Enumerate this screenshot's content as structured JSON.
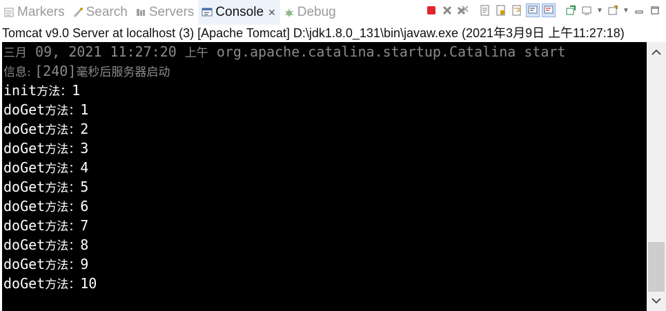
{
  "tabs": [
    {
      "label": "Markers",
      "icon": "markers-icon"
    },
    {
      "label": "Search",
      "icon": "search-icon"
    },
    {
      "label": "Servers",
      "icon": "servers-icon"
    },
    {
      "label": "Console",
      "icon": "console-icon",
      "close": "✕"
    },
    {
      "label": "Debug",
      "icon": "debug-icon"
    }
  ],
  "process_label": "Tomcat v9.0 Server at localhost (3) [Apache Tomcat] D:\\jdk1.8.0_131\\bin\\javaw.exe (2021年3月9日 上午11:27:18)",
  "console": {
    "log_line_1": {
      "prefix": "三月",
      "time": " 09, 2021 11:27:20 ",
      "ampm": "上午",
      "class": " org.apache.catalina.startup.Catalina start"
    },
    "log_line_2": {
      "prefix": "信息: ",
      "value": "[240]",
      "suffix": "毫秒后服务器启动"
    },
    "init_line": {
      "name": "init",
      "label": "方法：",
      "value": "1"
    },
    "doget_lines": [
      {
        "name": "doGet",
        "label": "方法：",
        "value": "1"
      },
      {
        "name": "doGet",
        "label": "方法：",
        "value": "2"
      },
      {
        "name": "doGet",
        "label": "方法：",
        "value": "3"
      },
      {
        "name": "doGet",
        "label": "方法：",
        "value": "4"
      },
      {
        "name": "doGet",
        "label": "方法：",
        "value": "5"
      },
      {
        "name": "doGet",
        "label": "方法：",
        "value": "6"
      },
      {
        "name": "doGet",
        "label": "方法：",
        "value": "7"
      },
      {
        "name": "doGet",
        "label": "方法：",
        "value": "8"
      },
      {
        "name": "doGet",
        "label": "方法：",
        "value": "9"
      },
      {
        "name": "doGet",
        "label": "方法：",
        "value": "10"
      }
    ]
  },
  "colors": {
    "terminate": "#e0242b",
    "console_bg": "#000000",
    "text": "#ffffff",
    "log_text": "#8a8a8a"
  }
}
